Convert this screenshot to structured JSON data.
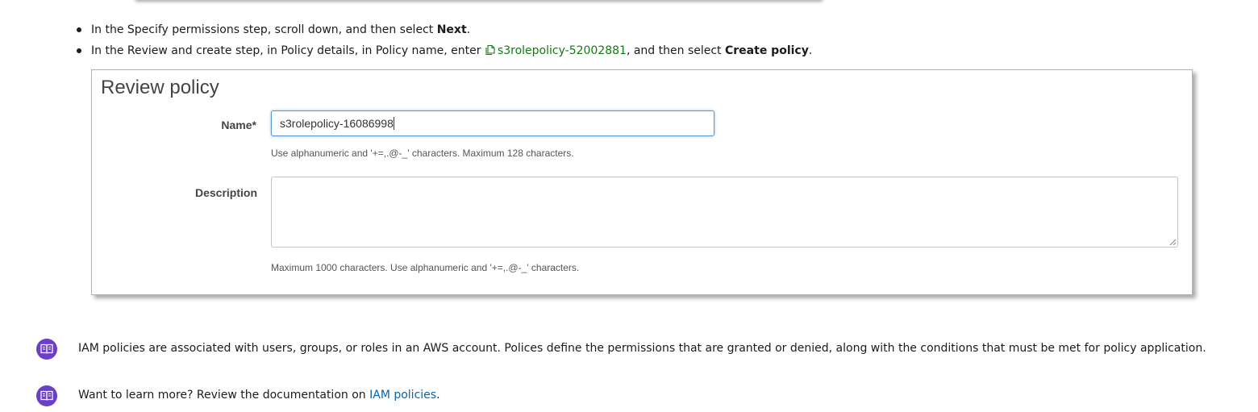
{
  "steps": [
    {
      "prefix": "In the Specify permissions step, scroll down, and then select ",
      "bold": "Next",
      "suffix": "."
    },
    {
      "prefix": "In the Review and create step, in Policy details, in Policy name, enter ",
      "code": "s3rolepolicy-52002881",
      "middle": ", and then select ",
      "bold": "Create policy",
      "suffix": "."
    }
  ],
  "review_policy": {
    "title": "Review policy",
    "name_label": "Name*",
    "name_value": "s3rolepolicy-16086998",
    "name_hint": "Use alphanumeric and '+=,.@-_' characters. Maximum 128 characters.",
    "description_label": "Description",
    "description_value": "",
    "description_hint": "Maximum 1000 characters. Use alphanumeric and '+=,.@-_' characters."
  },
  "notes": [
    {
      "icon": "book-icon",
      "text": "IAM policies are associated with users, groups, or roles in an AWS account. Polices define the permissions that are granted or denied, along with the conditions that must be met for policy application."
    },
    {
      "icon": "book-icon",
      "prefix": "Want to learn more? Review the documentation on ",
      "link": "IAM policies",
      "suffix": "."
    }
  ],
  "colors": {
    "code_green": "#107c10",
    "link_blue": "#0065b3",
    "note_icon_purple": "#6b3fc7",
    "input_focus_border": "#5b9bd5"
  }
}
